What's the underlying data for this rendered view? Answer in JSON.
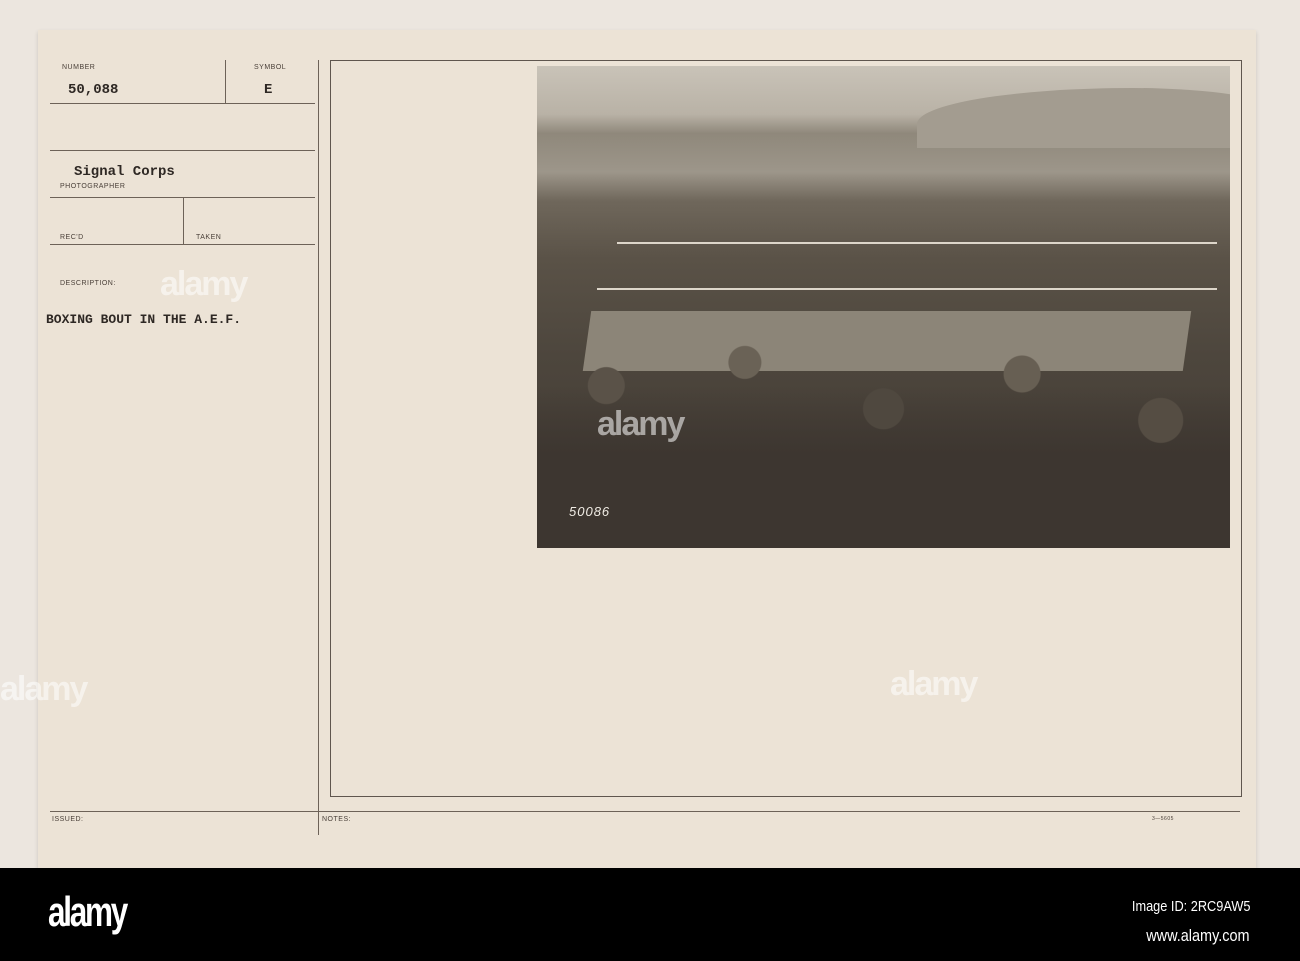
{
  "form": {
    "number_label": "NUMBER",
    "number_value": "50,088",
    "symbol_label": "SYMBOL",
    "symbol_value": "E",
    "photographer_value": "Signal Corps",
    "photographer_label": "PHOTOGRAPHER",
    "recd_label": "REC'D",
    "taken_label": "TAKEN",
    "description_label": "DESCRIPTION:",
    "description_value": "BOXING BOUT IN THE A.E.F.",
    "issued_label": "ISSUED:",
    "notes_label": "NOTES:",
    "form_code": "3—5605"
  },
  "photo": {
    "negative_number": "50086"
  },
  "watermark": {
    "text": "alamy"
  },
  "footer": {
    "logo": "alamy",
    "image_id": "Image ID: 2RC9AW5",
    "url": "www.alamy.com"
  }
}
